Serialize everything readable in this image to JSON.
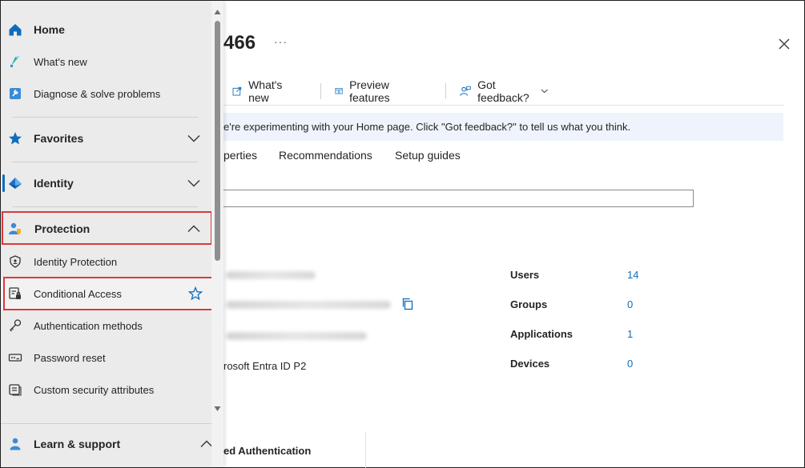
{
  "page": {
    "title_suffix": "466",
    "more_label": "···",
    "toolbar": {
      "whats_new": "What's new",
      "preview_features": "Preview features",
      "got_feedback": "Got feedback?"
    },
    "banner_text": "e're experimenting with your Home page. Click \"Got feedback?\" to tell us what you think.",
    "tabs": [
      "perties",
      "Recommendations",
      "Setup guides"
    ],
    "license_text": "rosoft Entra ID P2",
    "stats": [
      {
        "label": "Users",
        "value": "14"
      },
      {
        "label": "Groups",
        "value": "0"
      },
      {
        "label": "Applications",
        "value": "1"
      },
      {
        "label": "Devices",
        "value": "0"
      }
    ],
    "card_title": "ed Authentication"
  },
  "nav": {
    "home": "Home",
    "whats_new": "What's new",
    "diagnose": "Diagnose & solve problems",
    "favorites": "Favorites",
    "identity": "Identity",
    "protection": "Protection",
    "identity_protection": "Identity Protection",
    "conditional_access": "Conditional Access",
    "authentication_methods": "Authentication methods",
    "password_reset": "Password reset",
    "custom_security_attributes": "Custom security attributes",
    "learn_support": "Learn & support"
  },
  "colors": {
    "accent": "#0f6cbd",
    "highlight": "#d9393b",
    "nav_bg": "#ebebeb",
    "banner_bg": "#eff4fc"
  },
  "icons": {
    "home": "home-icon",
    "whats_new": "megaphone-icon",
    "diagnose": "wrench-icon",
    "favorites": "star-icon",
    "identity": "identity-diamond-icon",
    "protection": "user-shield-icon",
    "identity_protection": "shield-icon",
    "conditional_access": "policy-lock-icon",
    "authentication_methods": "key-icon",
    "password_reset": "password-icon",
    "custom_security_attributes": "tag-list-icon",
    "learn_support": "person-support-icon"
  }
}
